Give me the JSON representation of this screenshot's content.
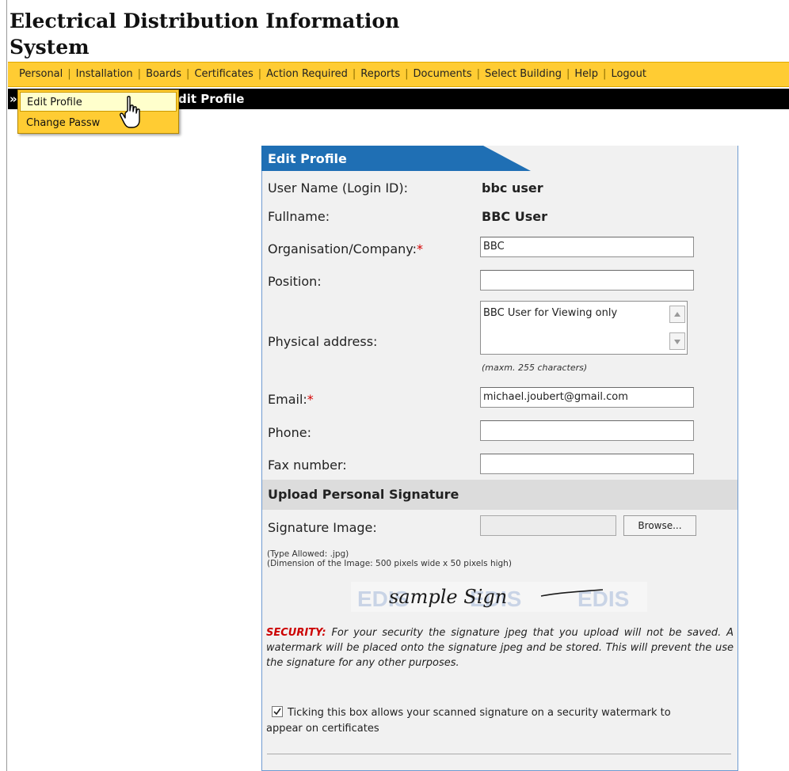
{
  "app": {
    "title_line1": "Electrical Distribution Information",
    "title_line2": "System"
  },
  "nav": {
    "items": [
      "Personal",
      "Installation",
      "Boards",
      "Certificates",
      "Action Required",
      "Reports",
      "Documents",
      "Select Building",
      "Help",
      "Logout"
    ],
    "separator": "|"
  },
  "breadcrumb": {
    "visible_text": "dit Profile",
    "prefix": "»"
  },
  "dropdown": {
    "items": [
      "Edit Profile",
      "Change Passw"
    ]
  },
  "form": {
    "tab_title": "Edit Profile",
    "username_label": "User Name (Login ID):",
    "username_value": "bbc user",
    "fullname_label": "Fullname:",
    "fullname_value": "BBC User",
    "organisation_label": "Organisation/Company:",
    "organisation_value": "BBC",
    "required_mark": "*",
    "position_label": "Position:",
    "position_value": "",
    "address_label": "Physical address:",
    "address_value": "BBC User for Viewing only",
    "address_note": "(maxm. 255 characters)",
    "email_label": "Email:",
    "email_value": "michael.joubert@gmail.com",
    "phone_label": "Phone:",
    "phone_value": "",
    "fax_label": "Fax number:",
    "fax_value": ""
  },
  "signature": {
    "section_title": "Upload Personal Signature",
    "image_label": "Signature Image:",
    "browse_label": "Browse...",
    "type_note": "(Type Allowed: .jpg)",
    "dimension_note": "(Dimension of the Image: 500 pixels wide x 50 pixels high)",
    "sample_script": "sample Sign",
    "watermark_text": "EDIS",
    "security_key": "SECURITY:",
    "security_text": "For your security the signature jpeg that you upload will not be saved. A watermark will be placed onto the signature jpeg and be stored. This will prevent the use the signature for any other purposes.",
    "checkbox_checked": true,
    "checkbox_label": "Ticking this box allows your scanned signature on a security watermark to appear on certificates"
  },
  "colors": {
    "nav_bg": "#ffcc33",
    "tab_bg": "#1f6fb4",
    "required": "#d40000",
    "security": "#cc0000"
  }
}
